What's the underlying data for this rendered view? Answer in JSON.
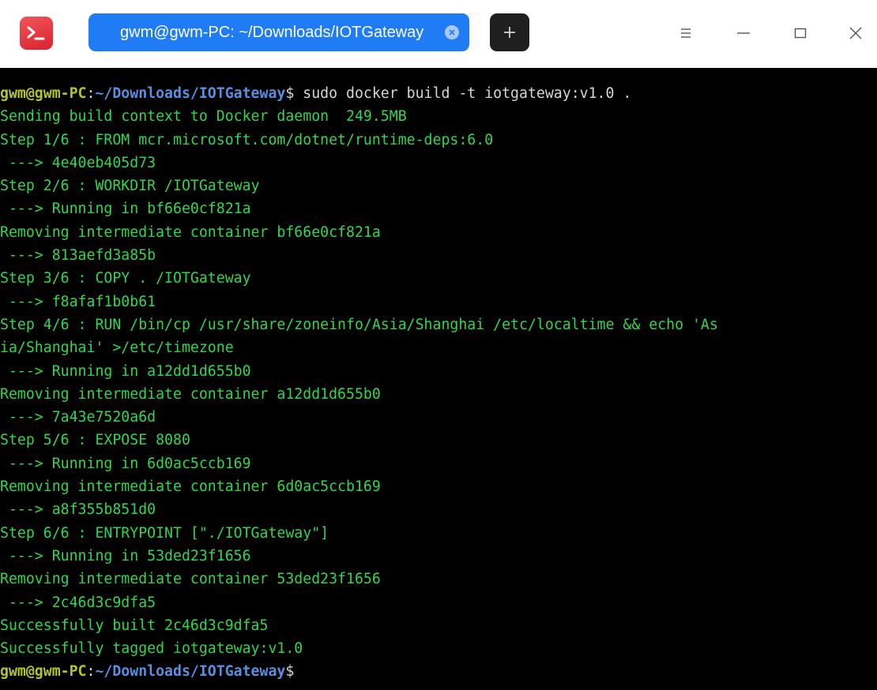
{
  "window": {
    "tab_title": "gwm@gwm-PC: ~/Downloads/IOTGateway"
  },
  "icons": {
    "app": "terminal-app-icon",
    "tab_close": "close-icon",
    "new_tab": "plus-icon",
    "menu": "hamburger-menu-icon",
    "minimize": "minimize-icon",
    "maximize": "maximize-icon",
    "close": "close-icon"
  },
  "colors": {
    "background": "#000000",
    "output_text": "#31d64f",
    "prompt_user": "#b4c428",
    "prompt_path": "#5a8fe0",
    "tab_active": "#1f7cf4",
    "app_icon": "#e0323c"
  },
  "prompt": {
    "user": "gwm@gwm-PC",
    "separator": ":",
    "path": "~/Downloads/IOTGateway",
    "symbol": "$"
  },
  "command": " sudo docker build -t iotgateway:v1.0 .",
  "output": [
    "Sending build context to Docker daemon  249.5MB",
    "Step 1/6 : FROM mcr.microsoft.com/dotnet/runtime-deps:6.0",
    " ---> 4e40eb405d73",
    "Step 2/6 : WORKDIR /IOTGateway",
    " ---> Running in bf66e0cf821a",
    "Removing intermediate container bf66e0cf821a",
    " ---> 813aefd3a85b",
    "Step 3/6 : COPY . /IOTGateway",
    " ---> f8afaf1b0b61",
    "Step 4/6 : RUN /bin/cp /usr/share/zoneinfo/Asia/Shanghai /etc/localtime && echo 'As",
    "ia/Shanghai' >/etc/timezone",
    " ---> Running in a12dd1d655b0",
    "Removing intermediate container a12dd1d655b0",
    " ---> 7a43e7520a6d",
    "Step 5/6 : EXPOSE 8080",
    " ---> Running in 6d0ac5ccb169",
    "Removing intermediate container 6d0ac5ccb169",
    " ---> a8f355b851d0",
    "Step 6/6 : ENTRYPOINT [\"./IOTGateway\"]",
    " ---> Running in 53ded23f1656",
    "Removing intermediate container 53ded23f1656",
    " ---> 2c46d3c9dfa5",
    "Successfully built 2c46d3c9dfa5",
    "Successfully tagged iotgateway:v1.0"
  ]
}
